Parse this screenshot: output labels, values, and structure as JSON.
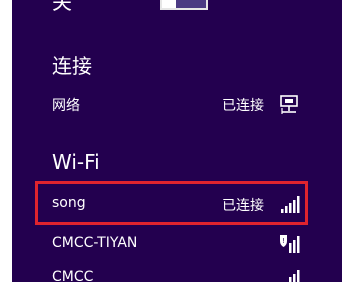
{
  "toggle": {
    "label": "关"
  },
  "sections": {
    "connections": {
      "title": "连接"
    },
    "wifi": {
      "title": "Wi-Fi"
    }
  },
  "network": {
    "name": "网络",
    "status": "已连接",
    "icon": "wired-network-icon"
  },
  "wifi_networks": [
    {
      "name": "song",
      "status": "已连接",
      "icon": "wifi-signal-icon",
      "selected": true
    },
    {
      "name": "CMCC-TIYAN",
      "status": "",
      "icon": "wifi-signal-shield-icon"
    },
    {
      "name": "CMCC",
      "status": "",
      "icon": "wifi-signal-icon"
    }
  ],
  "colors": {
    "panel_bg": "#23004f",
    "highlight": "#e0242e",
    "text": "#ffffff"
  }
}
